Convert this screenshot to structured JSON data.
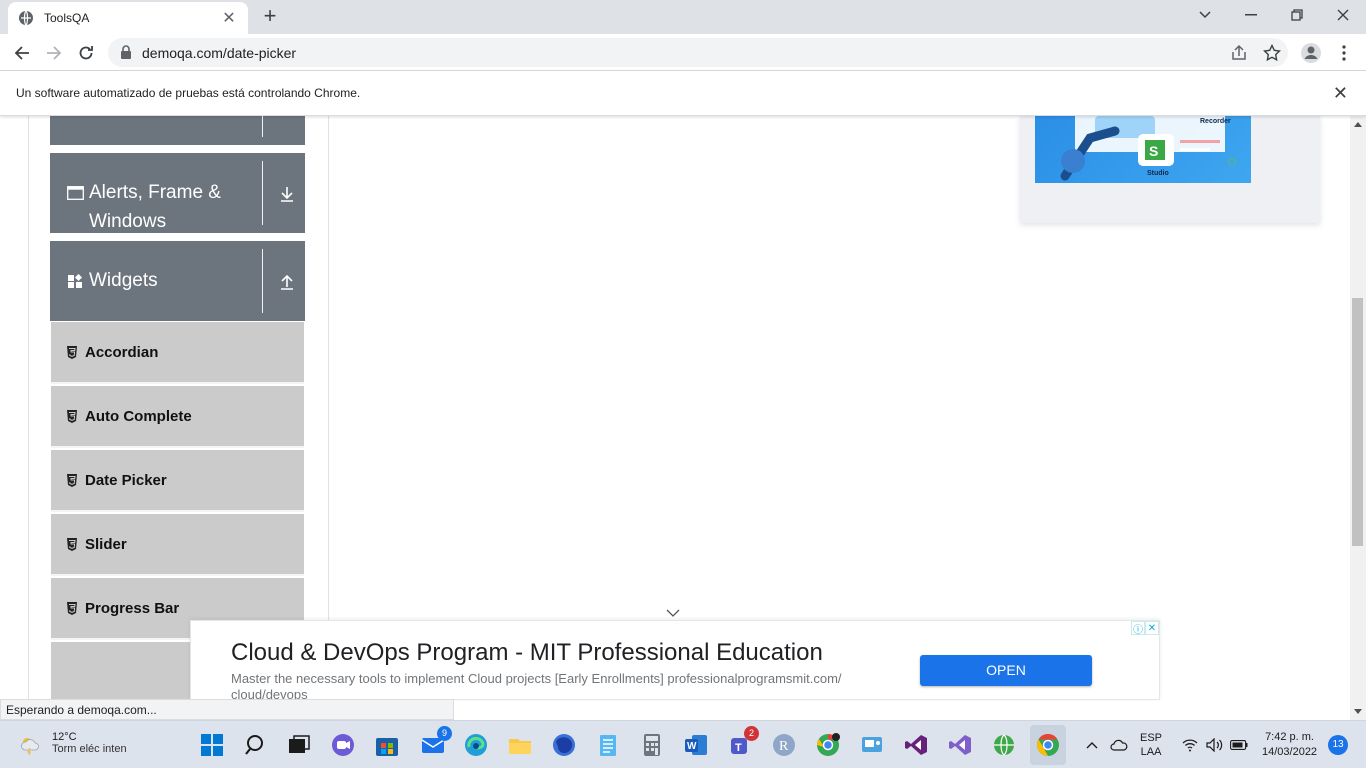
{
  "browser": {
    "tab_title": "ToolsQA",
    "url": "demoqa.com/date-picker",
    "automation_notice": "Un software automatizado de pruebas está controlando Chrome.",
    "status_text": "Esperando a demoqa.com..."
  },
  "sidebar": {
    "groups": [
      {
        "label": "Alerts, Frame &",
        "label2": "Windows",
        "icon": "window-icon",
        "arrow": "download-arrow-icon"
      },
      {
        "label": "Widgets",
        "icon": "widgets-icon",
        "arrow": "upload-arrow-icon"
      }
    ],
    "items": [
      {
        "label": "Accordian"
      },
      {
        "label": "Auto Complete"
      },
      {
        "label": "Date Picker"
      },
      {
        "label": "Slider"
      },
      {
        "label": "Progress Bar"
      }
    ]
  },
  "top_ad": {
    "recorder_label": "Recorder",
    "studio_label": "Studio"
  },
  "bottom_ad": {
    "headline": "Cloud & DevOps Program - MIT Professional Education",
    "description": "Master the necessary tools to implement Cloud projects [Early Enrollments] professionalprogramsmit.com/ cloud/devops",
    "button": "OPEN"
  },
  "taskbar": {
    "temperature": "12°C",
    "weather_condition": "Torm eléc inten",
    "mail_badge": "9",
    "teams_badge": "2",
    "language_top": "ESP",
    "language_bottom": "LAA",
    "time": "7:42 p. m.",
    "date": "14/03/2022",
    "notification_count": "13"
  },
  "colors": {
    "group_bg": "#6c757d",
    "item_bg": "#cbcbcb",
    "accent_blue": "#1a73e8"
  }
}
